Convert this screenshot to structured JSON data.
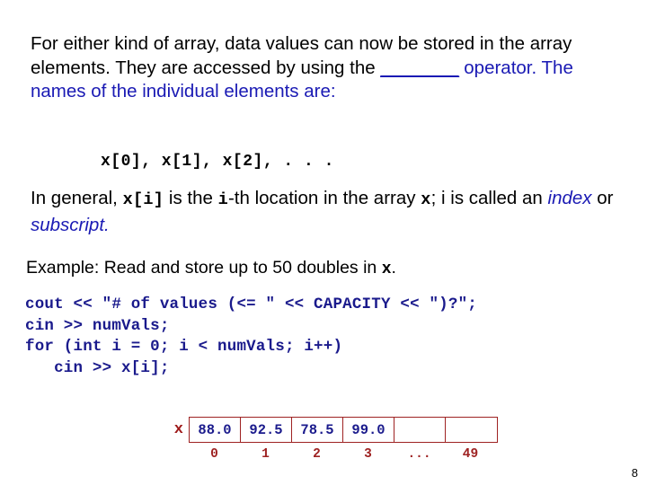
{
  "slide": {
    "page_number": "8",
    "colors": {
      "text": "#000000",
      "accent_blue": "#1a1ab4",
      "code_blue": "#1a1a8c",
      "table_border_red": "#9e2222",
      "label_red": "#9e1a1a",
      "background": "#ffffff"
    }
  },
  "paragraph": {
    "part1": "For either kind of array, data values can now be stored in the array elements.  They are accessed by using the ",
    "blank": "________",
    "part2": "operator",
    "part3": ".  The names of the individual elements are:"
  },
  "element_names": {
    "line": "x[0], x[1], x[2], . . ."
  },
  "general": {
    "lead": "In general,  ",
    "code1": "x[i]",
    "mid1": " is the ",
    "code2": "i",
    "mid2": "-th location in the array ",
    "code3": "x",
    "mid3": "; i is called an ",
    "italic1": "index",
    "mid4": " or ",
    "italic2": "subscript",
    "tail": "."
  },
  "example": {
    "text1": "Example: Read and store up to 50 doubles in ",
    "code": "x",
    "text2": "."
  },
  "code_block": {
    "lines": [
      "cout << \"# of values (<= \" << CAPACITY << \")?\";",
      "cin >> numVals;",
      "for (int i = 0; i < numVals; i++)",
      "   cin >> x[i];"
    ]
  },
  "array_diagram": {
    "label": "x",
    "cells": [
      "88.0",
      "92.5",
      "78.5",
      "99.0",
      "",
      ""
    ],
    "indices": [
      "0",
      "1",
      "2",
      "3",
      "...",
      "49"
    ]
  }
}
